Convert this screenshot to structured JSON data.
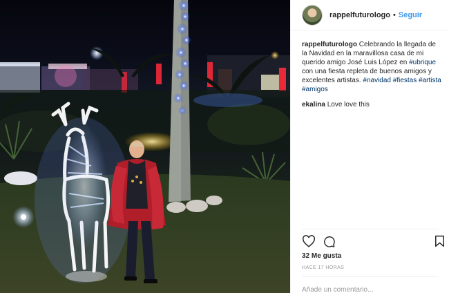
{
  "post": {
    "username": "rappelfuturologo",
    "separator": "•",
    "follow_label": "Seguir"
  },
  "caption": {
    "username": "rappelfuturologo",
    "text": "Celebrando la llegada de la Navidad en la maravillosa casa de mi querido amigo José Luis López en",
    "tag_ubrique": "#ubrique",
    "text2": "con una fiesta repleta de buenos amigos y excelentes artistas.",
    "tags": [
      "#navidad",
      "#fiestas",
      "#artista",
      "#amigos"
    ]
  },
  "comment": {
    "username": "ekalina",
    "text": "Love love this"
  },
  "stats": {
    "likes": "32 Me gusta",
    "time": "HACE 17 HORAS"
  },
  "add_comment": {
    "placeholder": "Añade un comentario..."
  },
  "icons": {
    "like": "heart-icon",
    "comment": "comment-bubble-icon",
    "save": "bookmark-icon"
  },
  "colors": {
    "link_blue": "#3897f0",
    "hashtag": "#003569",
    "muted": "#999999"
  }
}
